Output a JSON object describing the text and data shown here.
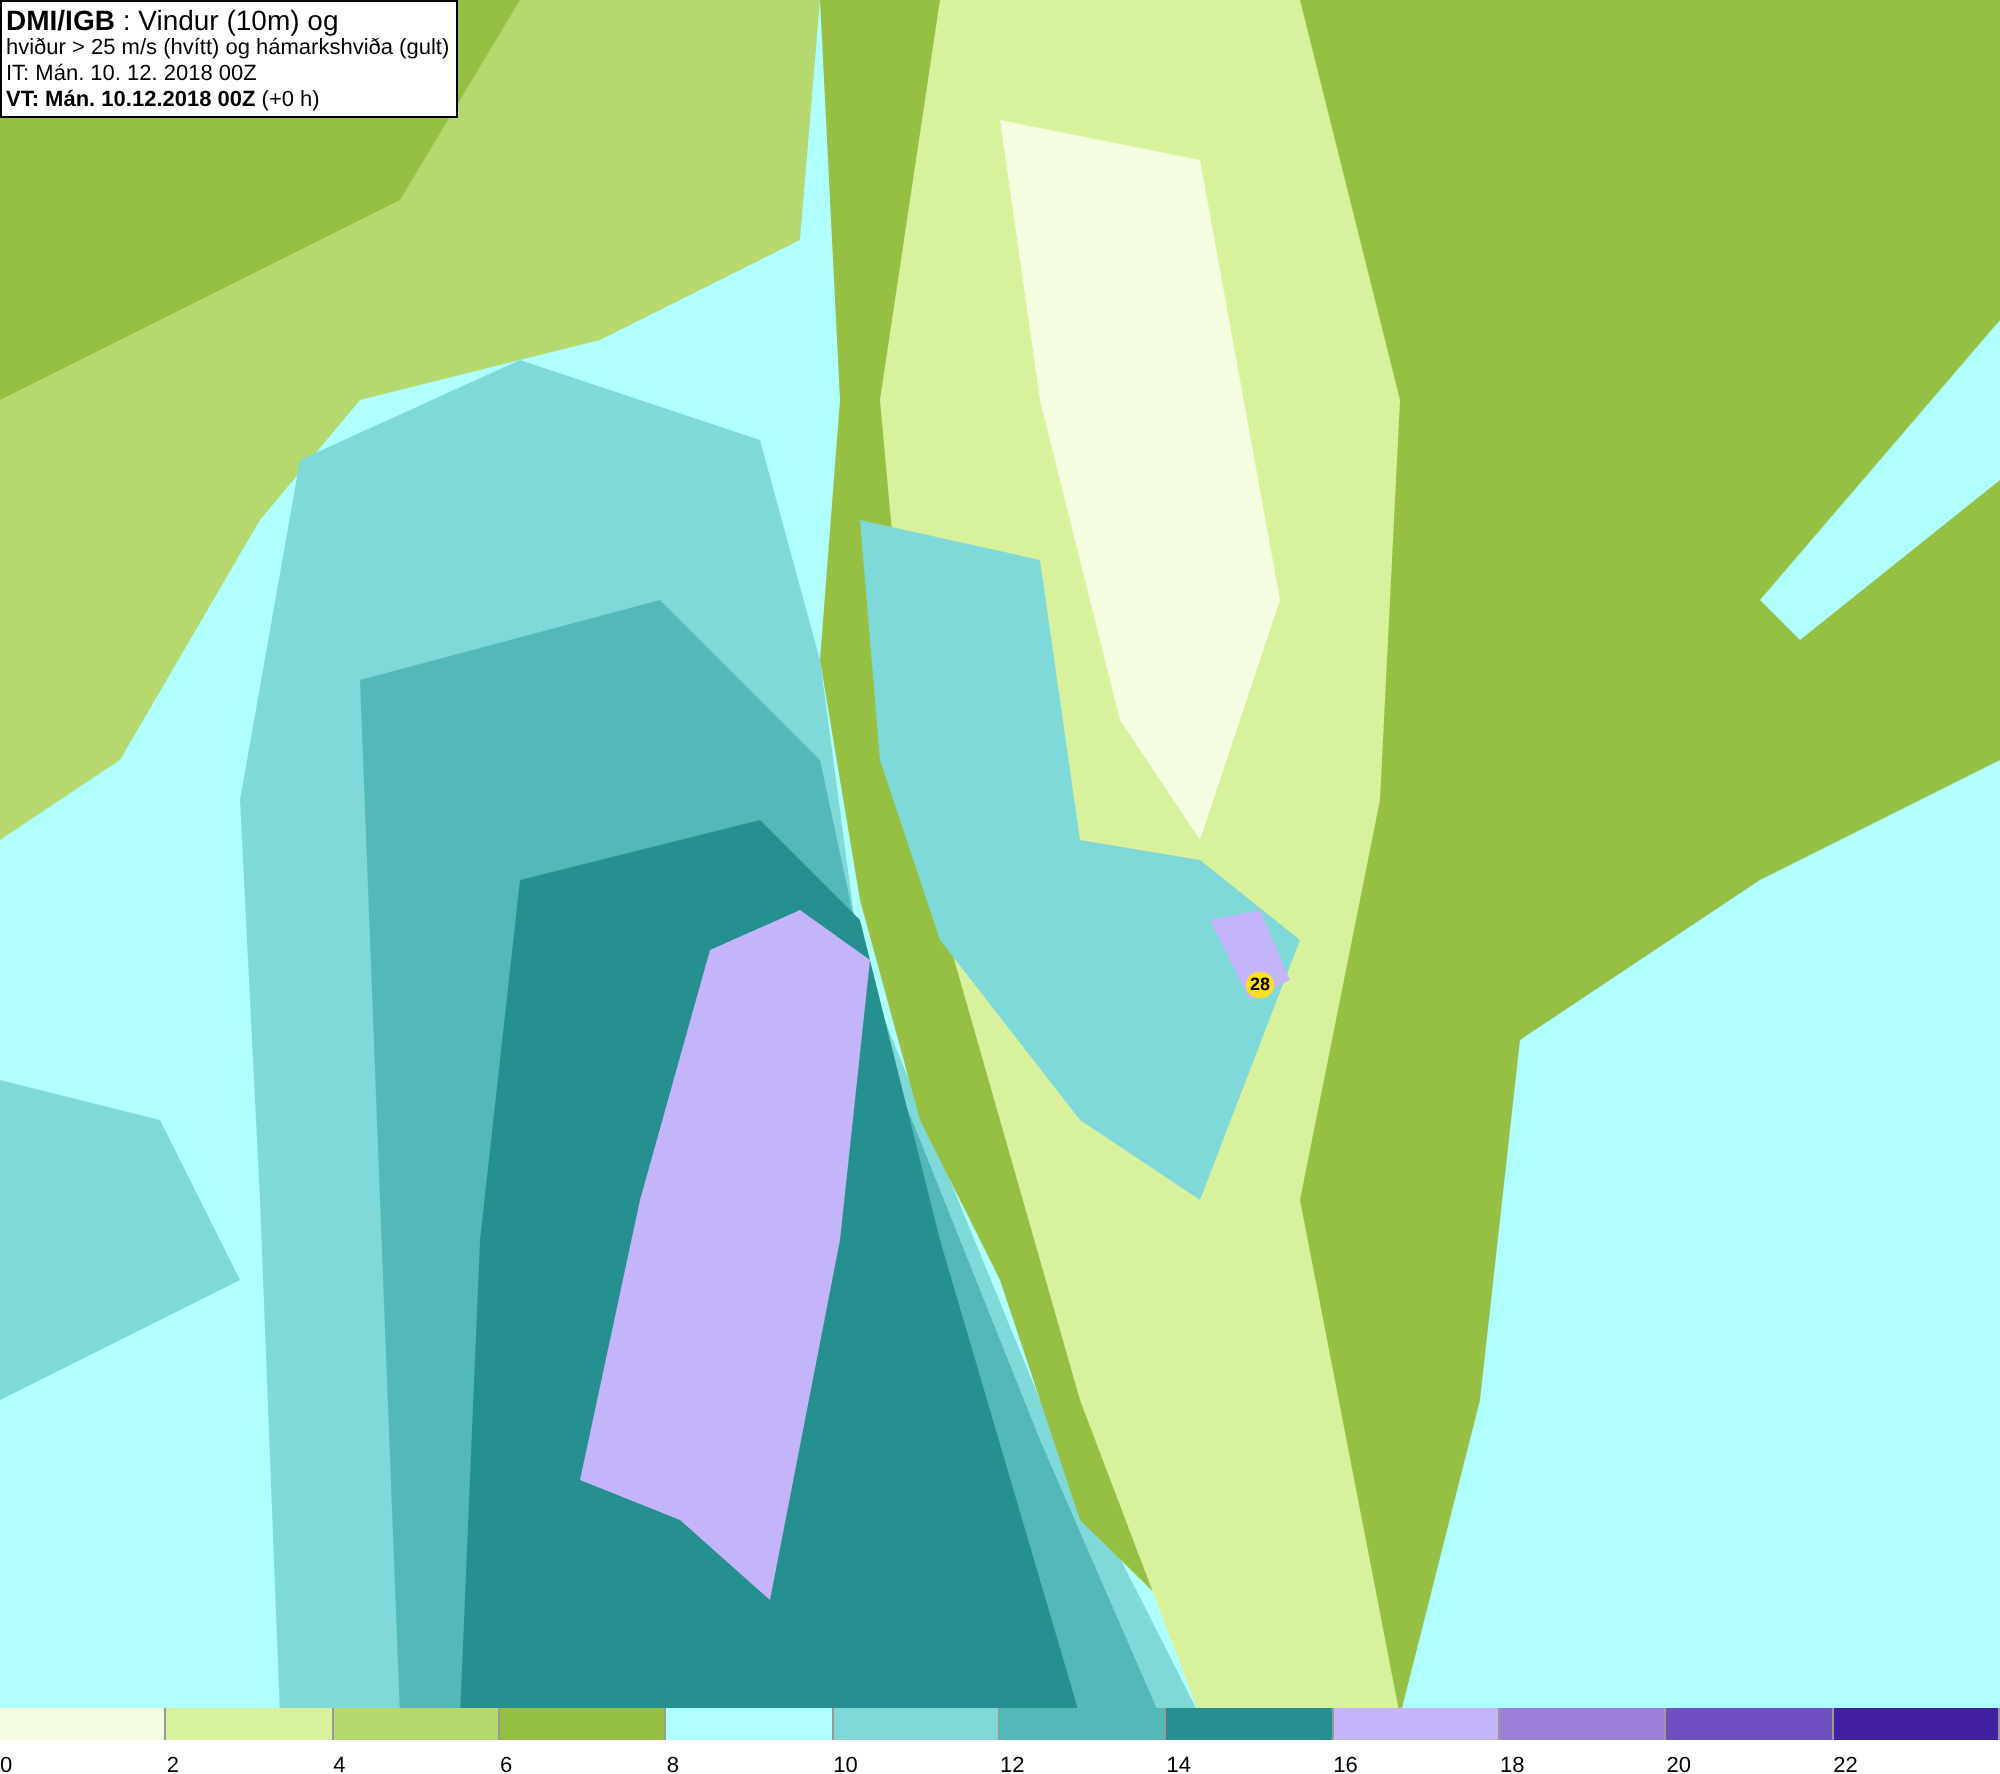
{
  "title_box": {
    "lines": [
      "**DMI/IGB** : Vindur (10m) og",
      "hviður > 25 m/s (hvítt) og hámarkshviða (gult)",
      "IT: Mán. 10. 12. 2018 00Z",
      "**VT: Mán. 10.12.2018 00Z** (+0 h)"
    ]
  },
  "max_gust_label": "28",
  "legend": [
    {
      "label": "0",
      "color": "#f5fde0"
    },
    {
      "label": "2",
      "color": "#d8f19c"
    },
    {
      "label": "4",
      "color": "#b5d96f"
    },
    {
      "label": "6",
      "color": "#96c043"
    },
    {
      "label": "8",
      "color": "#b0ffff"
    },
    {
      "label": "10",
      "color": "#80d9d9"
    },
    {
      "label": "12",
      "color": "#55b8b8"
    },
    {
      "label": "14",
      "color": "#269090"
    },
    {
      "label": "16",
      "color": "#c4b5fa"
    },
    {
      "label": "18",
      "color": "#9b7fd9"
    },
    {
      "label": "20",
      "color": "#7050c0"
    },
    {
      "label": "22",
      "color": "#4020a0"
    }
  ]
}
